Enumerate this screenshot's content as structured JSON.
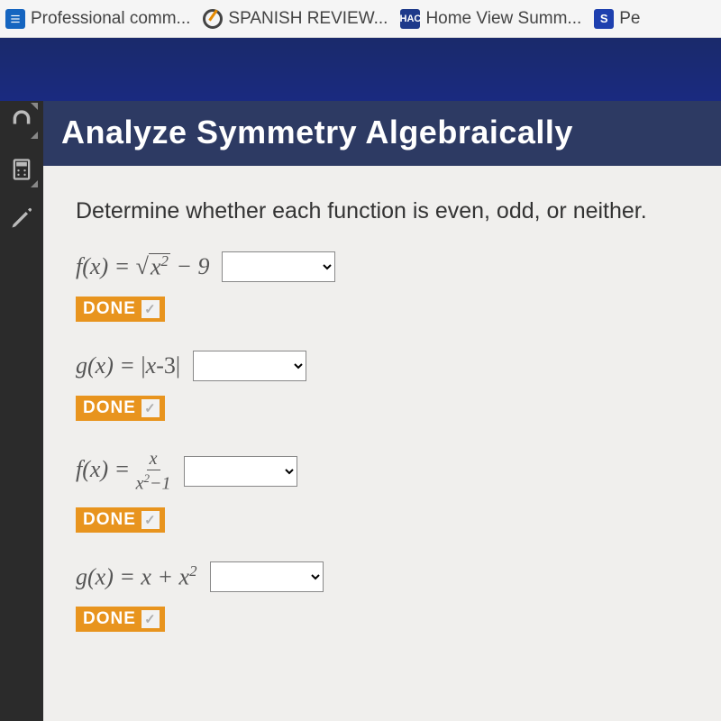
{
  "bookmarks": [
    {
      "label": "Professional comm..."
    },
    {
      "label": "SPANISH REVIEW..."
    },
    {
      "label": "Home View Summ..."
    },
    {
      "label": "Pe"
    }
  ],
  "title": "Analyze Symmetry Algebraically",
  "instruction": "Determine whether each function is even, odd, or neither.",
  "done_label": "DONE",
  "problems": {
    "p1": {
      "fn_label": "f",
      "expr_html": "√(x² − 9)"
    },
    "p2": {
      "fn_label": "g",
      "expr_html": "|x-3|"
    },
    "p3": {
      "fn_label": "f",
      "expr_html": "x / (x² − 1)"
    },
    "p4": {
      "fn_label": "g",
      "expr_html": "x + x²"
    }
  },
  "icons": {
    "hac": "HAC",
    "s": "S"
  }
}
